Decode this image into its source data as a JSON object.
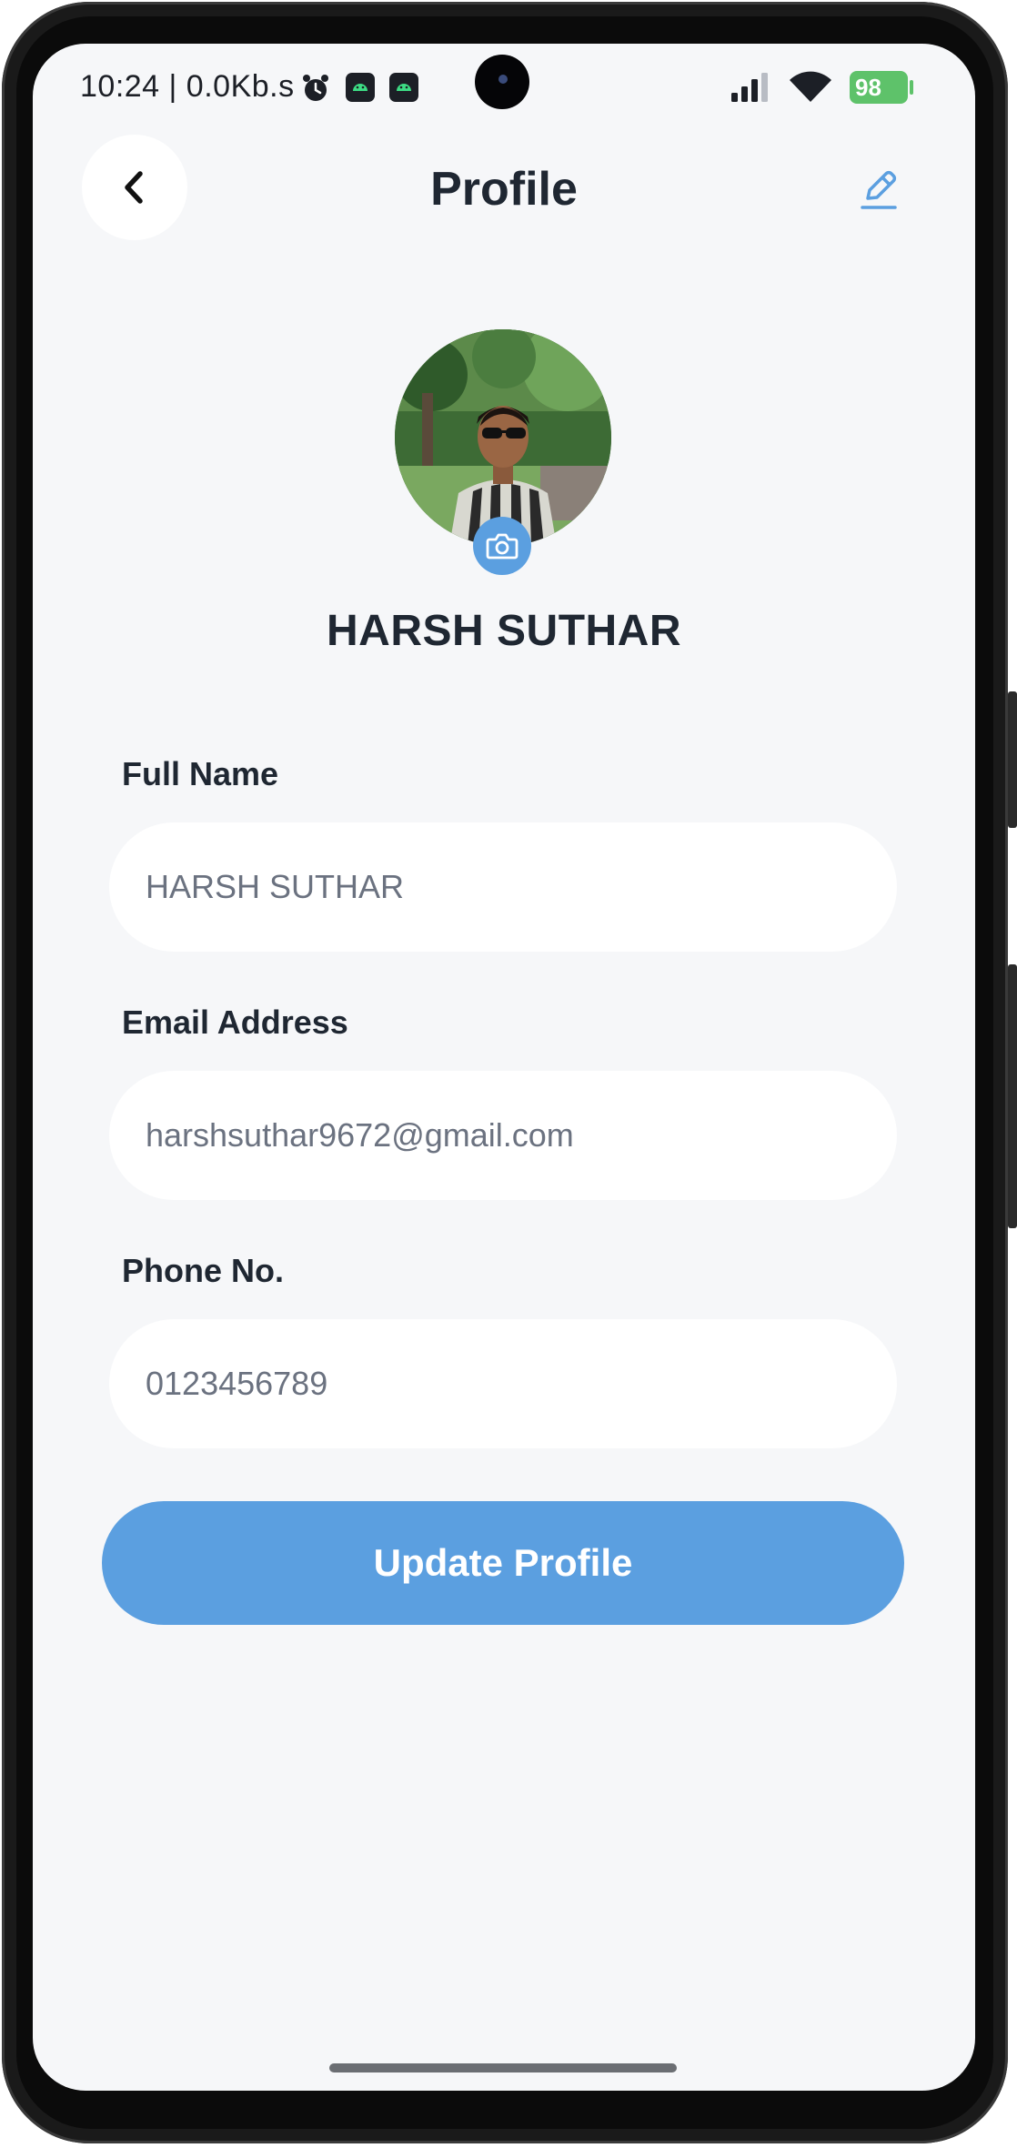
{
  "status_bar": {
    "time": "10:24 | 0.0Kb.s",
    "battery": "98"
  },
  "header": {
    "title": "Profile",
    "back_icon": "chevron-left-icon",
    "edit_icon": "pencil-icon"
  },
  "profile": {
    "name": "HARSH SUTHAR",
    "camera_icon": "camera-icon"
  },
  "form": {
    "full_name": {
      "label": "Full Name",
      "value": "HARSH SUTHAR"
    },
    "email": {
      "label": "Email Address",
      "value": "harshsuthar9672@gmail.com"
    },
    "phone": {
      "label": "Phone No.",
      "value": "0123456789"
    },
    "submit_label": "Update Profile"
  },
  "colors": {
    "accent": "#5b9fe0",
    "background": "#f6f7f9",
    "text": "#1f2732",
    "input_text": "#6b7280"
  }
}
